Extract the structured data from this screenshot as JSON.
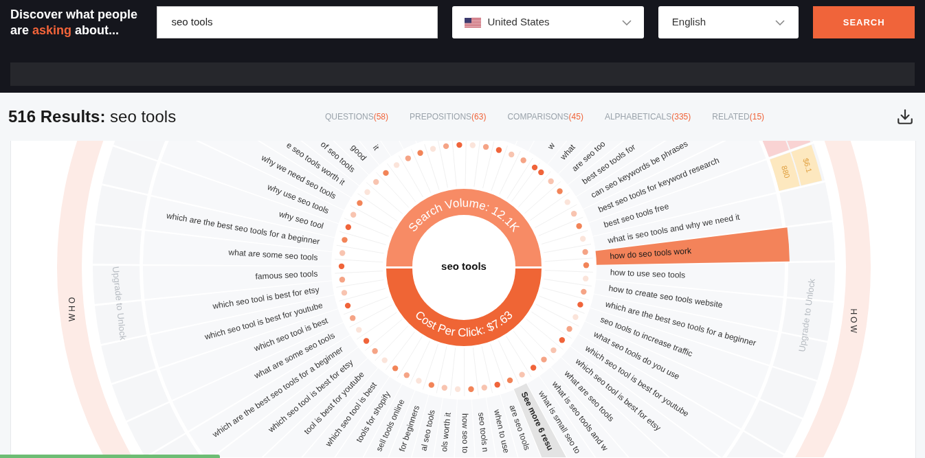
{
  "header": {
    "headline": {
      "before": "Discover what people are ",
      "highlight": "asking",
      "after": " about..."
    },
    "search_field": {
      "value": "seo tools"
    },
    "country_select": {
      "value": "United States"
    },
    "language_select": {
      "value": "English"
    },
    "search_button": "SEARCH"
  },
  "results": {
    "count_label": "516 Results:",
    "query": "seo tools",
    "tabs": [
      {
        "label": "QUESTIONS",
        "count": "(58)"
      },
      {
        "label": "PREPOSITIONS",
        "count": "(63)"
      },
      {
        "label": "COMPARISONS",
        "count": "(45)"
      },
      {
        "label": "ALPHABETICALS",
        "count": "(335)"
      },
      {
        "label": "RELATED",
        "count": "(15)"
      }
    ]
  },
  "wheel": {
    "center": "seo tools",
    "search_volume": "Search Volume: 12.1K",
    "cost_per_click": "Cost Per Click: $7.63",
    "sections": [
      {
        "label": "WHO",
        "note": "Upgrade to Unlock"
      },
      {
        "label": "HOW",
        "note": "Upgrade to Unlock"
      }
    ],
    "questions": [
      {
        "kind": "question",
        "text": "w",
        "selected": false
      },
      {
        "kind": "question",
        "text": "what",
        "selected": false
      },
      {
        "kind": "question",
        "text": "are seo too",
        "selected": false
      },
      {
        "kind": "question",
        "text": "best seo tools for",
        "selected": false
      },
      {
        "kind": "question",
        "text": "can seo keywords be phrases",
        "selected": false
      },
      {
        "kind": "question",
        "text": "best seo tools for keyword research",
        "selected": false,
        "cells": [
          {
            "color": "#f9d3d3"
          },
          {
            "color": "#f9d3d3"
          }
        ]
      },
      {
        "kind": "question",
        "text": "best seo tools free",
        "selected": false,
        "cells": [
          {
            "color": "#fde8bf",
            "text": "880"
          },
          {
            "color": "#fde8bf",
            "text": "$6.1"
          }
        ]
      },
      {
        "kind": "question",
        "text": "what is seo tools and why we need it",
        "selected": false
      },
      {
        "kind": "question",
        "text": "how do seo tools work",
        "selected": true
      },
      {
        "kind": "question",
        "text": "how to use seo tools",
        "selected": false
      },
      {
        "kind": "question",
        "text": "how to create seo tools website",
        "selected": false
      },
      {
        "kind": "question",
        "text": "which are the best seo tools for a beginner",
        "selected": false
      },
      {
        "kind": "question",
        "text": "seo tools to increase traffic",
        "selected": false
      },
      {
        "kind": "question",
        "text": "what seo tools do you use",
        "selected": false
      },
      {
        "kind": "question",
        "text": "which seo tool is best for youtube",
        "selected": false
      },
      {
        "kind": "question",
        "text": "which seo tool is best for etsy",
        "selected": false
      },
      {
        "kind": "question",
        "text": "what are seo tools",
        "selected": false
      },
      {
        "kind": "question",
        "text": "what is seo tools and w",
        "selected": false
      },
      {
        "kind": "question",
        "text": "what is small seo to",
        "selected": false
      },
      {
        "kind": "more",
        "text": "See more 6 resu",
        "selected": false
      },
      {
        "kind": "question",
        "text": "are seo tools",
        "selected": false
      },
      {
        "kind": "question",
        "text": "when to use",
        "selected": false
      },
      {
        "kind": "question",
        "text": "seo tools n",
        "selected": false
      },
      {
        "kind": "question",
        "text": "how seo to",
        "selected": false
      },
      {
        "kind": "question",
        "text": "ols worth it",
        "selected": false
      },
      {
        "kind": "question",
        "text": "al seo tools",
        "selected": false
      },
      {
        "kind": "question",
        "text": "for beginners",
        "selected": false
      },
      {
        "kind": "question",
        "text": "sell tools online",
        "selected": false
      },
      {
        "kind": "question",
        "text": "tools for shopify",
        "selected": false
      },
      {
        "kind": "question",
        "text": "which seo tool is best",
        "selected": false
      },
      {
        "kind": "question",
        "text": "tool is best for youtube",
        "selected": false
      },
      {
        "kind": "question",
        "text": "which seo tool is best for etsy",
        "selected": false
      },
      {
        "kind": "question",
        "text": "which are the best seo tools for a beginner",
        "selected": false
      },
      {
        "kind": "question",
        "text": "what are some seo tools",
        "selected": false
      },
      {
        "kind": "question",
        "text": "which seo tool is best",
        "selected": false
      },
      {
        "kind": "question",
        "text": "which seo tool is best for youtube",
        "selected": false
      },
      {
        "kind": "question",
        "text": "which seo tool is best for etsy",
        "selected": false
      },
      {
        "kind": "question",
        "text": "famous seo tools",
        "selected": false
      },
      {
        "kind": "question",
        "text": "what are some seo tools",
        "selected": false
      },
      {
        "kind": "question",
        "text": "which are the best seo tools for a beginner",
        "selected": false
      },
      {
        "kind": "question",
        "text": "why seo tool",
        "selected": false
      },
      {
        "kind": "question",
        "text": "why use seo tools",
        "selected": false
      },
      {
        "kind": "question",
        "text": "why we need seo tools",
        "selected": false
      },
      {
        "kind": "question",
        "text": "e seo tools worth it",
        "selected": false
      },
      {
        "kind": "question",
        "text": "of seo tools",
        "selected": false
      },
      {
        "kind": "question",
        "text": "good",
        "selected": false
      },
      {
        "kind": "question",
        "text": "it",
        "selected": false
      }
    ]
  }
}
